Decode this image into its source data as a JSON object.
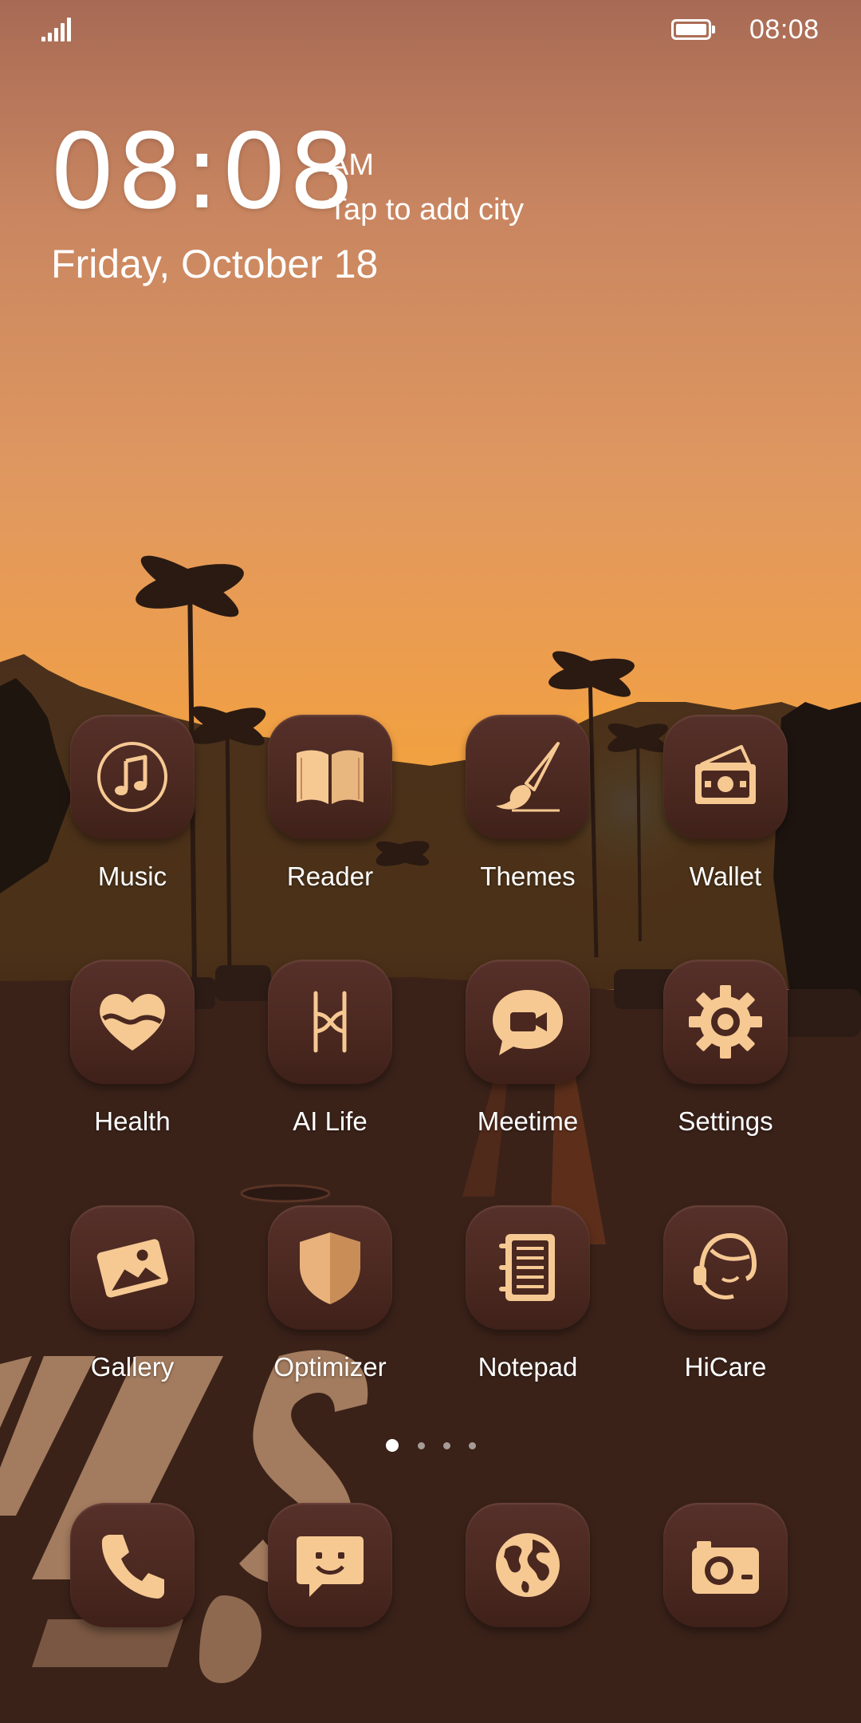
{
  "status_bar": {
    "time": "08:08",
    "signal_icon": "signal-bars-icon",
    "battery_icon": "battery-full-icon"
  },
  "clock_widget": {
    "time": "08:08",
    "ampm": "AM",
    "city_prompt": "Tap to add city",
    "date": "Friday, October 18"
  },
  "theme": {
    "tile_color": "#4a2820",
    "icon_color": "#f6c993",
    "text_color": "#ffffff"
  },
  "apps": [
    {
      "label": "Music",
      "icon": "music-note-icon"
    },
    {
      "label": "Reader",
      "icon": "open-book-icon"
    },
    {
      "label": "Themes",
      "icon": "paintbrush-icon"
    },
    {
      "label": "Wallet",
      "icon": "wallet-icon"
    },
    {
      "label": "Health",
      "icon": "heart-icon"
    },
    {
      "label": "AI Life",
      "icon": "ai-life-icon"
    },
    {
      "label": "Meetime",
      "icon": "video-chat-icon"
    },
    {
      "label": "Settings",
      "icon": "gear-icon"
    },
    {
      "label": "Gallery",
      "icon": "picture-icon"
    },
    {
      "label": "Optimizer",
      "icon": "shield-icon"
    },
    {
      "label": "Notepad",
      "icon": "notepad-icon"
    },
    {
      "label": "HiCare",
      "icon": "headset-icon"
    }
  ],
  "page_indicator": {
    "pages": 4,
    "current": 1
  },
  "dock": [
    {
      "icon": "phone-icon"
    },
    {
      "icon": "messages-icon"
    },
    {
      "icon": "globe-icon"
    },
    {
      "icon": "camera-icon"
    }
  ]
}
